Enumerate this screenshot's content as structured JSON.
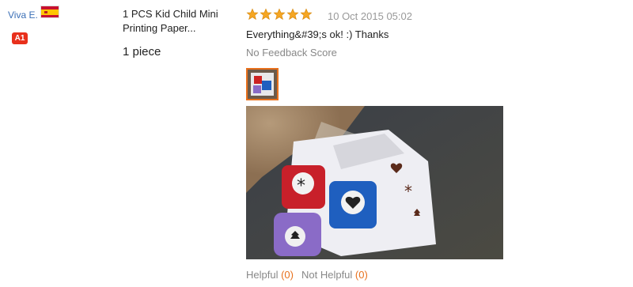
{
  "buyer": {
    "name": "Viva E.",
    "level": "A1",
    "country_flag": "spain-flag-icon"
  },
  "product": {
    "title": "1 PCS Kid Child Mini Printing Paper...",
    "quantity": "1 piece"
  },
  "review": {
    "rating": 5,
    "rating_max": 5,
    "date": "10 Oct 2015 05:02",
    "text": "Everything&#39;s ok! :) Thanks",
    "feedback_score": "No Feedback Score",
    "star_color": "#f5a623"
  },
  "helpful": {
    "helpful_label": "Helpful",
    "helpful_count": "(0)",
    "not_helpful_label": "Not Helpful",
    "not_helpful_count": "(0)"
  },
  "colors": {
    "link": "#3b6fb6",
    "badge": "#e8301c",
    "accent": "#e8701c"
  }
}
